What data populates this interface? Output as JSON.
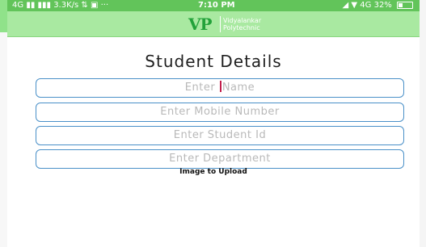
{
  "status_bar": {
    "network": "4G",
    "speed": "3.3K/s",
    "time": "7:10 PM",
    "battery": "32%",
    "signal_right": "4G"
  },
  "app_bar": {
    "logo_mark": "VP",
    "logo_line1": "Vidyalankar",
    "logo_line2": "Polytechnic"
  },
  "form": {
    "title": "Student Details",
    "fields": [
      {
        "placeholder_before_cursor": "Enter ",
        "placeholder_after_cursor": "Name"
      },
      {
        "placeholder": "Enter Mobile Number"
      },
      {
        "placeholder": "Enter Student Id"
      },
      {
        "placeholder": "Enter Department"
      }
    ],
    "upload_label": "Image to Upload"
  },
  "colors": {
    "status_bar": "#62c45a",
    "app_bar": "#a9e9a1",
    "field_border": "#4a90c8",
    "cursor": "#c21d4b"
  }
}
